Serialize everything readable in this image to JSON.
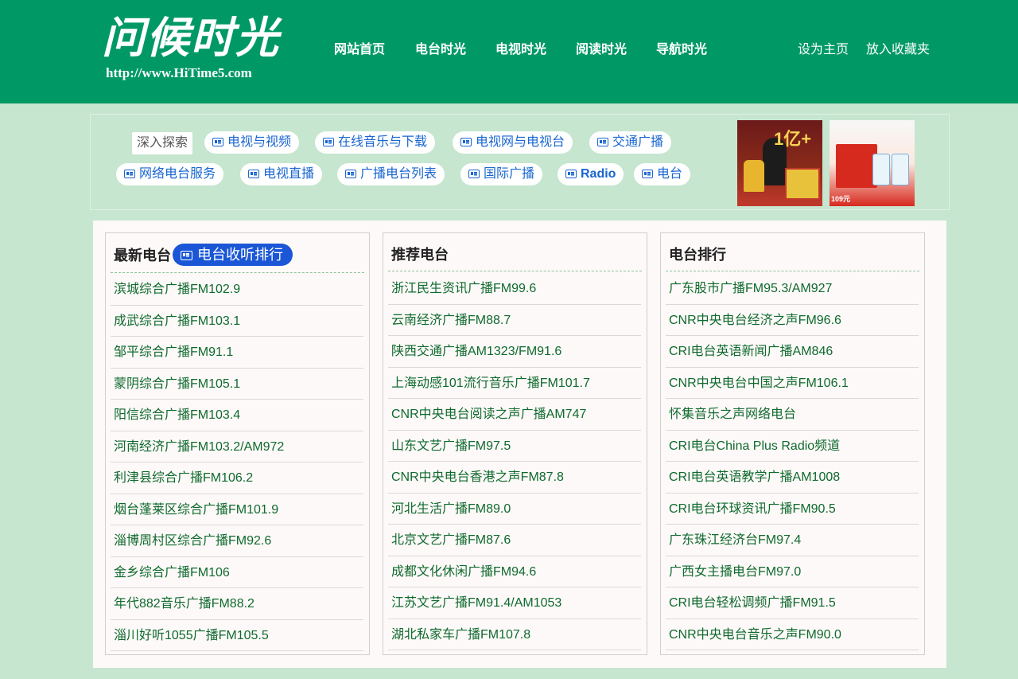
{
  "header": {
    "logo_text": "问候时光",
    "logo_url": "http://www.HiTime5.com",
    "nav": [
      "网站首页",
      "电台时光",
      "电视时光",
      "阅读时光",
      "导航时光"
    ],
    "set_home": "设为主页",
    "add_favorite": "放入收藏夹"
  },
  "explore": {
    "label": "深入探索",
    "tags": [
      "电视与视频",
      "在线音乐与下载",
      "电视网与电视台",
      "交通广播",
      "网络电台服务",
      "电视直播",
      "广播电台列表",
      "国际广播",
      "Radio",
      "电台"
    ]
  },
  "ads": {
    "ad1_text": "1亿+",
    "ad2_text": "109元"
  },
  "latest": {
    "title": "最新电台",
    "rank_button": "电台收听排行",
    "items": [
      "滨城综合广播FM102.9",
      "成武综合广播FM103.1",
      "邹平综合广播FM91.1",
      "蒙阴综合广播FM105.1",
      "阳信综合广播FM103.4",
      "河南经济广播FM103.2/AM972",
      "利津县综合广播FM106.2",
      "烟台蓬莱区综合广播FM101.9",
      "淄博周村区综合广播FM92.6",
      "金乡综合广播FM106",
      "年代882音乐广播FM88.2",
      "淄川好听1055广播FM105.5"
    ]
  },
  "recommended": {
    "title": "推荐电台",
    "items": [
      "浙江民生资讯广播FM99.6",
      "云南经济广播FM88.7",
      "陕西交通广播AM1323/FM91.6",
      "上海动感101流行音乐广播FM101.7",
      "CNR中央电台阅读之声广播AM747",
      "山东文艺广播FM97.5",
      "CNR中央电台香港之声FM87.8",
      "河北生活广播FM89.0",
      "北京文艺广播FM87.6",
      "成都文化休闲广播FM94.6",
      "江苏文艺广播FM91.4/AM1053",
      "湖北私家车广播FM107.8"
    ]
  },
  "ranking": {
    "title": "电台排行",
    "items": [
      "广东股市广播FM95.3/AM927",
      "CNR中央电台经济之声FM96.6",
      "CRI电台英语新闻广播AM846",
      "CNR中央电台中国之声FM106.1",
      "怀集音乐之声网络电台",
      "CRI电台China Plus Radio频道",
      "CRI电台英语教学广播AM1008",
      "CRI电台环球资讯广播FM90.5",
      "广东珠江经济台FM97.4",
      "广西女主播电台FM97.0",
      "CRI电台轻松调频广播FM91.5",
      "CNR中央电台音乐之声FM90.0"
    ]
  }
}
